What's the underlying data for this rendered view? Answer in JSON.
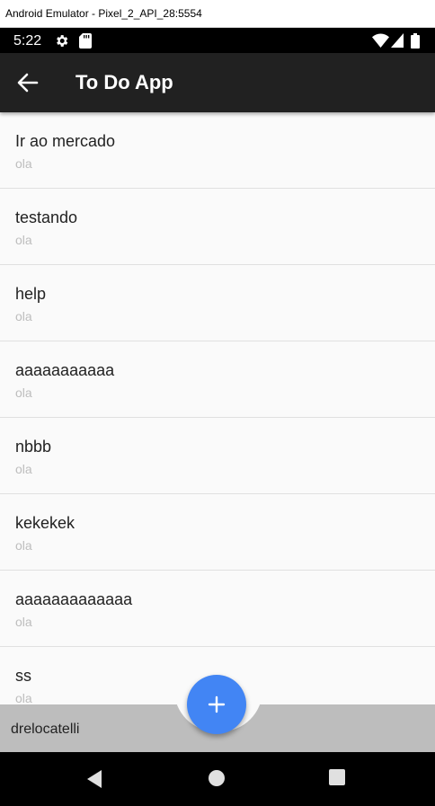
{
  "window": {
    "title": "Android Emulator - Pixel_2_API_28:5554"
  },
  "statusbar": {
    "time": "5:22"
  },
  "appbar": {
    "title": "To Do App"
  },
  "todos": [
    {
      "title": "Ir ao mercado",
      "subtitle": "ola"
    },
    {
      "title": "testando",
      "subtitle": "ola"
    },
    {
      "title": "help",
      "subtitle": "ola"
    },
    {
      "title": "aaaaaaaaaaa",
      "subtitle": "ola"
    },
    {
      "title": "nbbb",
      "subtitle": "ola"
    },
    {
      "title": "kekekek",
      "subtitle": "ola"
    },
    {
      "title": "aaaaaaaaaaaaa",
      "subtitle": "ola"
    },
    {
      "title": "ss",
      "subtitle": "ola"
    }
  ],
  "bottombar": {
    "username": "drelocatelli"
  },
  "icons": {
    "back": "arrow-back-icon",
    "add": "plus-icon",
    "settings": "gear-icon",
    "sdcard": "sd-card-icon",
    "wifi": "wifi-icon",
    "signal": "signal-icon",
    "battery": "battery-icon",
    "nav_back": "nav-back-icon",
    "nav_home": "nav-home-icon",
    "nav_recents": "nav-recents-icon"
  },
  "colors": {
    "appbar": "#212121",
    "fab": "#4285f4",
    "bottombar": "#bdbdbd",
    "list_bg": "#fafafa",
    "subtitle": "#bdbdbd"
  }
}
